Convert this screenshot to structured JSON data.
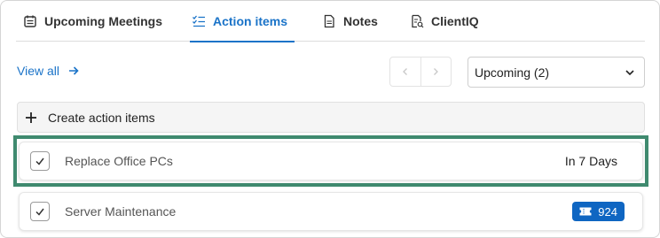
{
  "tabs": [
    {
      "label": "Upcoming Meetings",
      "icon": "calendar-icon",
      "active": false
    },
    {
      "label": "Action items",
      "icon": "checklist-icon",
      "active": true
    },
    {
      "label": "Notes",
      "icon": "document-icon",
      "active": false
    },
    {
      "label": "ClientIQ",
      "icon": "clientiq-icon",
      "active": false
    }
  ],
  "toolbar": {
    "view_all_label": "View all",
    "filter_value": "Upcoming (2)"
  },
  "create_label": "Create action items",
  "items": [
    {
      "title": "Replace Office PCs",
      "due": "In 7 Days",
      "highlighted": true
    },
    {
      "title": "Server Maintenance",
      "ticket": "924",
      "ticket_icon": "ticket-icon"
    }
  ],
  "colors": {
    "accent": "#1a73c8",
    "highlight_border": "#3f8a6f",
    "badge_bg": "#0f66c2"
  }
}
